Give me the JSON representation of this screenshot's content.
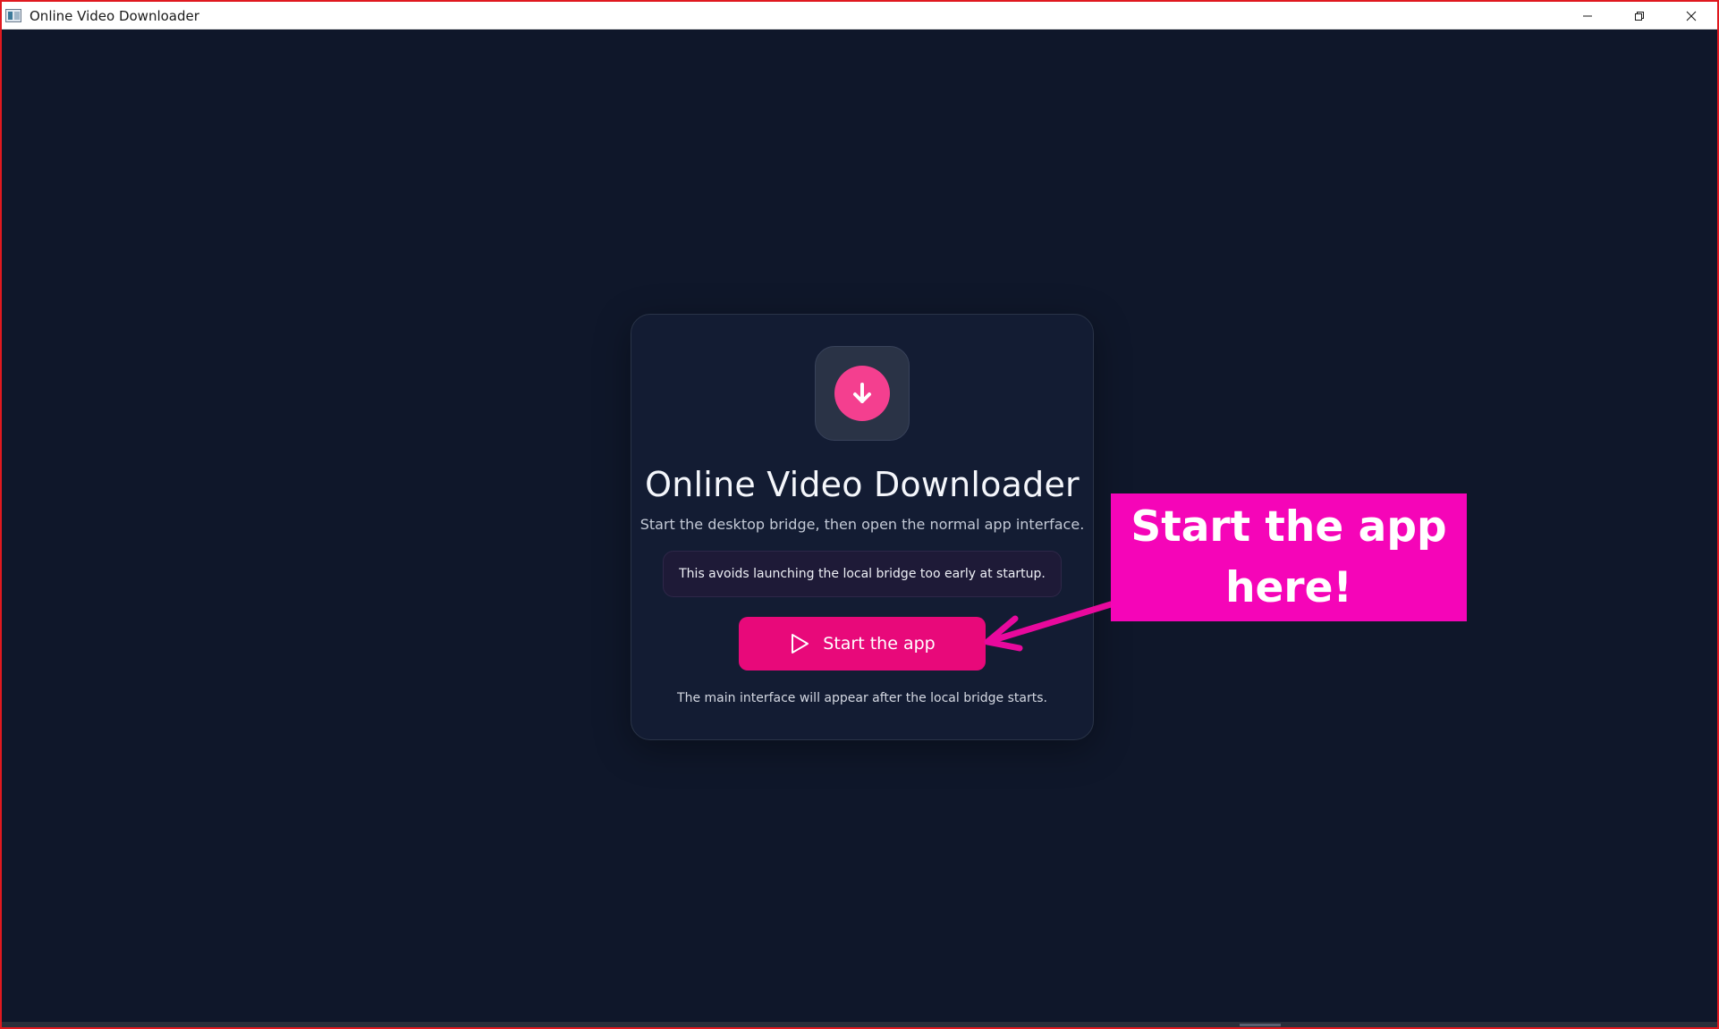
{
  "window": {
    "title": "Online Video Downloader",
    "controls": [
      "minimize-icon",
      "restore-icon",
      "close-icon"
    ]
  },
  "card": {
    "logo_icon": "download-arrow-icon",
    "title": "Online Video Downloader",
    "subtitle": "Start the desktop bridge, then open the normal app interface.",
    "notice": "This avoids launching the local bridge too early at startup.",
    "start_button": {
      "icon": "play-icon",
      "label": "Start the app"
    },
    "footnote": "The main interface will appear after the local bridge starts."
  },
  "annotation": {
    "text": "Start the app here!",
    "color": "#f505b8"
  },
  "colors": {
    "background": "#0f172a",
    "card": "#131c33",
    "accent": "#e8097a",
    "logo_circle": "#f43f8f"
  }
}
